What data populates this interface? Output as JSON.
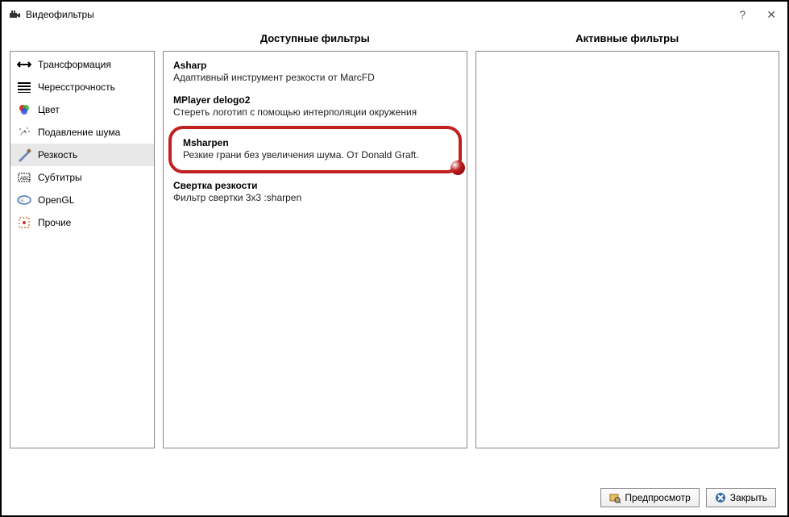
{
  "window": {
    "title": "Видеофильтры",
    "help_label": "?",
    "close_label": "✕"
  },
  "headers": {
    "available": "Доступные фильтры",
    "active": "Активные фильтры"
  },
  "categories": [
    {
      "id": "transform",
      "label": "Трансформация",
      "selected": false
    },
    {
      "id": "interlace",
      "label": "Чересстрочность",
      "selected": false
    },
    {
      "id": "color",
      "label": "Цвет",
      "selected": false
    },
    {
      "id": "denoise",
      "label": "Подавление шума",
      "selected": false
    },
    {
      "id": "sharpness",
      "label": "Резкость",
      "selected": true
    },
    {
      "id": "subtitles",
      "label": "Субтитры",
      "selected": false
    },
    {
      "id": "opengl",
      "label": "OpenGL",
      "selected": false
    },
    {
      "id": "other",
      "label": "Прочие",
      "selected": false
    }
  ],
  "available_filters": [
    {
      "name": "Asharp",
      "desc": "Адаптивный инструмент резкости от MarcFD",
      "highlighted": false
    },
    {
      "name": "MPlayer delogo2",
      "desc": "Стереть логотип с помощью интерполяции окружения",
      "highlighted": false
    },
    {
      "name": "Msharpen",
      "desc": "Резкие грани без увеличения шума. От Donald Graft.",
      "highlighted": true
    },
    {
      "name": "Свертка резкости",
      "desc": "Фильтр свертки 3x3 :sharpen",
      "highlighted": false
    }
  ],
  "buttons": {
    "preview": "Предпросмотр",
    "close": "Закрыть"
  }
}
